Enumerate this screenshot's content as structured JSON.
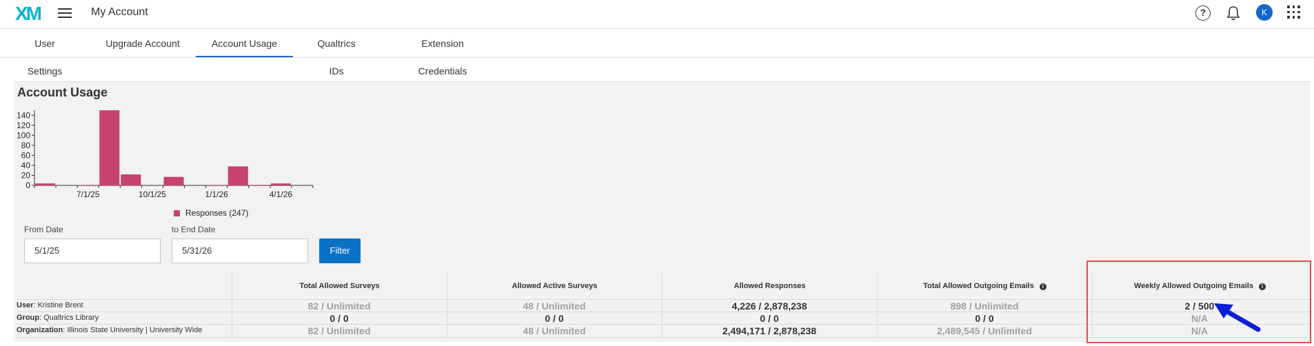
{
  "header": {
    "logo": "XM",
    "title": "My Account",
    "avatar_initial": "K",
    "icons": [
      "menu-icon",
      "help-icon",
      "bell-icon",
      "apps-grid-icon"
    ]
  },
  "tabs": [
    {
      "label": "User Settings",
      "active": false
    },
    {
      "label": "Upgrade Account",
      "active": false
    },
    {
      "label": "Account Usage",
      "active": true
    },
    {
      "label": "Qualtrics IDs",
      "active": false
    },
    {
      "label": "Extension Credentials",
      "active": false
    }
  ],
  "usage": {
    "title": "Account Usage",
    "legend": "Responses (247)",
    "from_label": "From Date",
    "from_value": "5/1/25",
    "to_label": "to End Date",
    "to_value": "5/31/26",
    "filter_label": "Filter"
  },
  "chart_data": {
    "type": "bar",
    "categories": [
      "May 25",
      "Jun 25",
      "Jul 25",
      "Aug 25",
      "Sep 25",
      "Oct 25",
      "Nov 25",
      "Dec 25",
      "Jan 26",
      "Feb 26",
      "Mar 26",
      "Apr 26",
      "May 26"
    ],
    "x_tick_labels": [
      "7/1/25",
      "10/1/25",
      "1/1/26",
      "4/1/26"
    ],
    "series": [
      {
        "name": "Responses (247)",
        "color": "#c8426f",
        "values": [
          4,
          0,
          1,
          150,
          22,
          0,
          17,
          0,
          1,
          38,
          1,
          4,
          0
        ]
      }
    ],
    "y_ticks": [
      0,
      20,
      40,
      60,
      80,
      100,
      120,
      140
    ],
    "ylim": [
      0,
      150
    ],
    "title": "",
    "xlabel": "",
    "ylabel": ""
  },
  "table": {
    "headers": [
      "Total Allowed Surveys",
      "Allowed Active Surveys",
      "Allowed Responses",
      "Total Allowed Outgoing Emails",
      "Weekly Allowed Outgoing Emails"
    ],
    "rows": [
      {
        "label_key": "User",
        "label_value": ": Kristine Brent",
        "cells": [
          {
            "text": "82 / Unlimited",
            "tone": "gray"
          },
          {
            "text": "48 / Unlimited",
            "tone": "gray"
          },
          {
            "text": "4,226 / 2,878,238",
            "tone": "dark"
          },
          {
            "text": "898 / Unlimited",
            "tone": "gray"
          },
          {
            "text": "2 / 500",
            "tone": "dark"
          }
        ]
      },
      {
        "label_key": "Group",
        "label_value": ": Qualtrics Library",
        "cells": [
          {
            "text": "0 / 0",
            "tone": "dark"
          },
          {
            "text": "0 / 0",
            "tone": "dark"
          },
          {
            "text": "0 / 0",
            "tone": "dark"
          },
          {
            "text": "0 / 0",
            "tone": "dark"
          },
          {
            "text": "N/A",
            "tone": "gray"
          }
        ]
      },
      {
        "label_key": "Organization",
        "label_value": ": Illinois State University | University Wide",
        "cells": [
          {
            "text": "82 / Unlimited",
            "tone": "gray"
          },
          {
            "text": "48 / Unlimited",
            "tone": "gray"
          },
          {
            "text": "2,494,171 / 2,878,238",
            "tone": "dark"
          },
          {
            "text": "2,489,545 / Unlimited",
            "tone": "gray"
          },
          {
            "text": "N/A",
            "tone": "gray"
          }
        ]
      }
    ]
  },
  "annotations": {
    "highlight_color": "#e44a4a",
    "arrow_color": "#0a1ed6"
  }
}
